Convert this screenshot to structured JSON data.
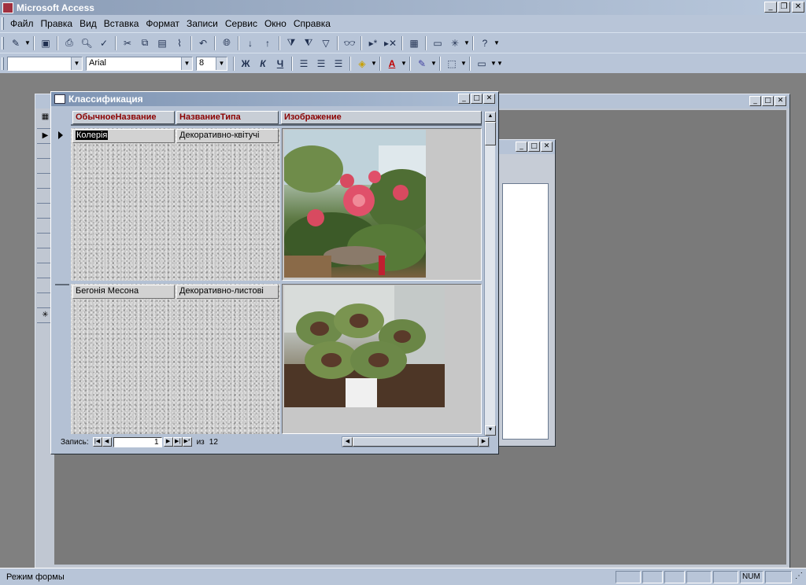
{
  "app": {
    "title": "Microsoft Access"
  },
  "menu": [
    "Файл",
    "Правка",
    "Вид",
    "Вставка",
    "Формат",
    "Записи",
    "Сервис",
    "Окно",
    "Справка"
  ],
  "format_toolbar": {
    "object_combo": "",
    "font": "Arial",
    "size": "8"
  },
  "form_window": {
    "title": "Классификация",
    "columns": [
      "ОбычноеНазвание",
      "НазваниеТипа",
      "Изображение"
    ],
    "records": [
      {
        "common_name": "Колерія",
        "type_name": "Декоративно-квітучі",
        "image": "flower-photo"
      },
      {
        "common_name": "Бегонія Месона",
        "type_name": "Декоративно-листові",
        "image": "begonia-photo"
      }
    ],
    "navigator": {
      "label": "Запись:",
      "current": "1",
      "of_label": "из",
      "total": "12"
    }
  },
  "status": {
    "mode": "Режим формы",
    "num": "NUM"
  }
}
